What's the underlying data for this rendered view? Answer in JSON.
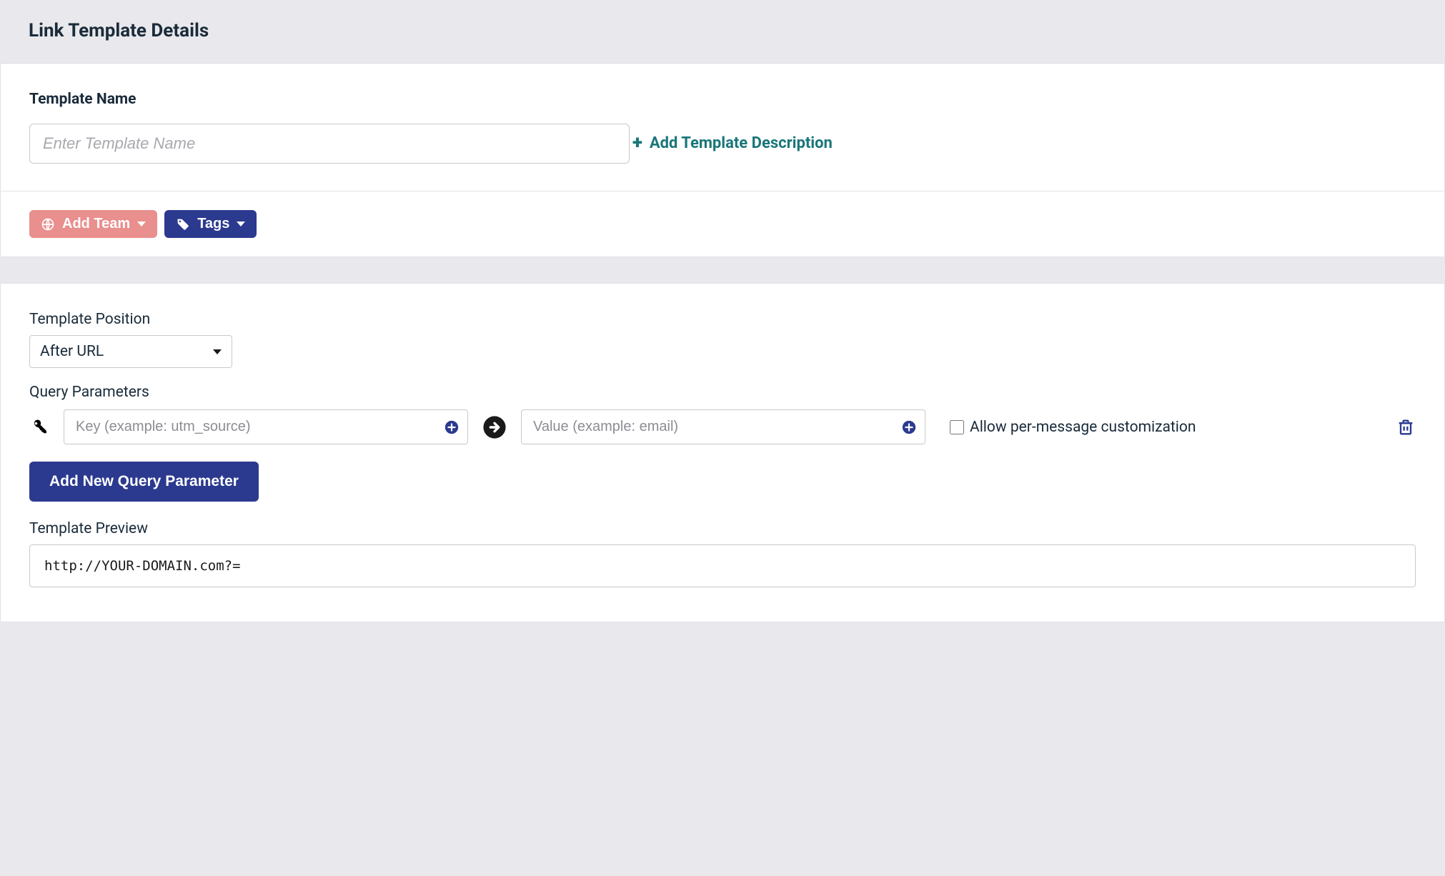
{
  "header": {
    "title": "Link Template Details"
  },
  "form": {
    "name_label": "Template Name",
    "name_placeholder": "Enter Template Name",
    "name_value": "",
    "add_description": "Add Template Description"
  },
  "meta_buttons": {
    "add_team": "Add Team",
    "tags": "Tags"
  },
  "position": {
    "label": "Template Position",
    "selected": "After URL"
  },
  "query": {
    "label": "Query Parameters",
    "key_placeholder": "Key (example: utm_source)",
    "key_value": "",
    "value_placeholder": "Value (example: email)",
    "value_value": "",
    "allow_custom_label": "Allow per-message customization",
    "add_btn": "Add New Query Parameter"
  },
  "preview": {
    "label": "Template Preview",
    "value": "http://YOUR-DOMAIN.com?="
  }
}
